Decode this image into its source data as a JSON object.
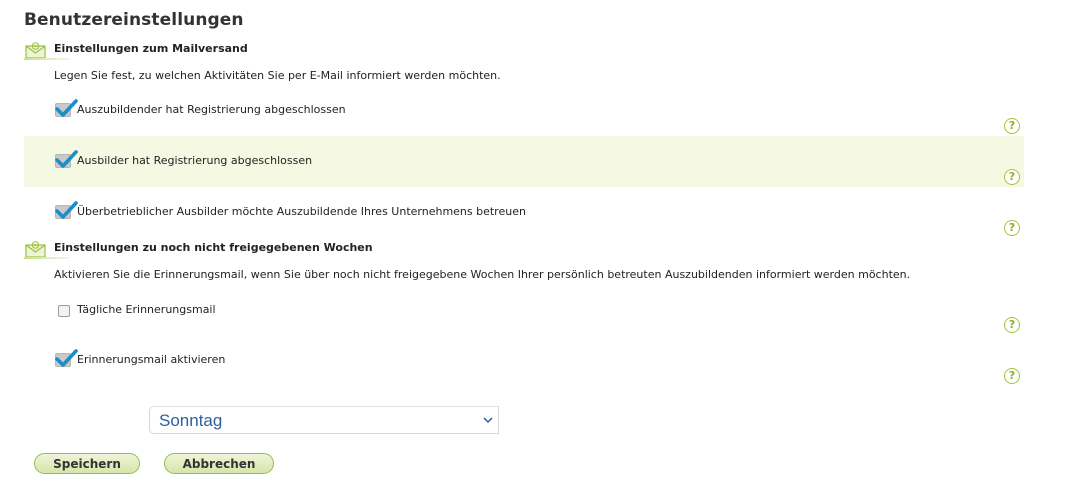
{
  "page": {
    "title": "Benutzereinstellungen"
  },
  "sections": [
    {
      "title": "Einstellungen zum Mailversand",
      "description": "Legen Sie fest, zu welchen Aktivitäten Sie per E-Mail informiert werden möchten.",
      "options": [
        {
          "label": "Auszubildender hat Registrierung abgeschlossen",
          "checked": true
        },
        {
          "label": "Ausbilder hat Registrierung abgeschlossen",
          "checked": true
        },
        {
          "label": "Überbetrieblicher Ausbilder möchte Auszubildende Ihres Unternehmens betreuen",
          "checked": true
        }
      ]
    },
    {
      "title": "Einstellungen zu noch nicht freigegebenen Wochen",
      "description": "Aktivieren Sie die Erinnerungsmail, wenn Sie über noch nicht freigegebene Wochen Ihrer persönlich betreuten Auszubildenden informiert werden möchten.",
      "options": [
        {
          "label": "Tägliche Erinnerungsmail",
          "checked": false
        },
        {
          "label": "Erinnerungsmail aktivieren",
          "checked": true
        }
      ]
    }
  ],
  "help_glyph": "?",
  "weekday_select": {
    "value": "Sonntag"
  },
  "buttons": {
    "save": "Speichern",
    "cancel": "Abbrechen"
  },
  "colors": {
    "accent_green": "#a5c63b",
    "highlight_row": "#f5f9e4",
    "check_blue": "#1a8fc7",
    "select_text": "#2c5fa1"
  }
}
